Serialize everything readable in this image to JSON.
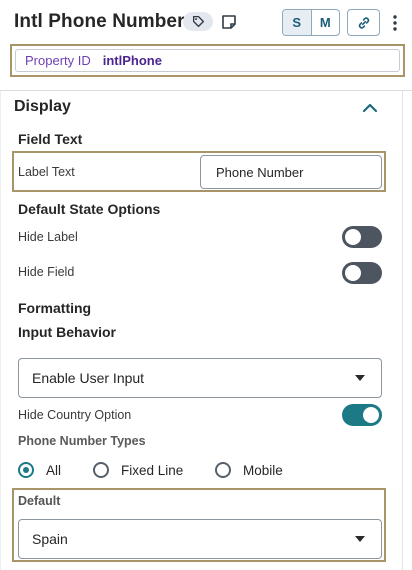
{
  "header": {
    "title": "Intl Phone Number",
    "size_buttons": [
      "S",
      "M"
    ],
    "active_size": "S",
    "icons": [
      "tag-icon",
      "note-icon",
      "link-icon",
      "more-vertical-icon"
    ]
  },
  "property": {
    "label": "Property ID",
    "value": "intlPhone"
  },
  "display": {
    "title": "Display",
    "field_text": {
      "heading": "Field Text",
      "label_text_label": "Label Text",
      "label_text_value": "Phone Number"
    },
    "default_state": {
      "heading": "Default State Options",
      "hide_label": {
        "label": "Hide Label",
        "on": false
      },
      "hide_field": {
        "label": "Hide Field",
        "on": false
      }
    },
    "formatting": {
      "heading": "Formatting"
    },
    "input_behavior": {
      "heading": "Input Behavior",
      "selected": "Enable User Input",
      "hide_country": {
        "label": "Hide Country Option",
        "on": true
      }
    },
    "phone_types": {
      "heading": "Phone Number Types",
      "options": [
        "All",
        "Fixed Line",
        "Mobile"
      ],
      "selected": "All"
    },
    "default": {
      "label": "Default",
      "selected": "Spain"
    }
  },
  "colors": {
    "accent": "#1c7a86",
    "highlight_border": "#a8956a",
    "property_label": "#6f3fb2"
  }
}
